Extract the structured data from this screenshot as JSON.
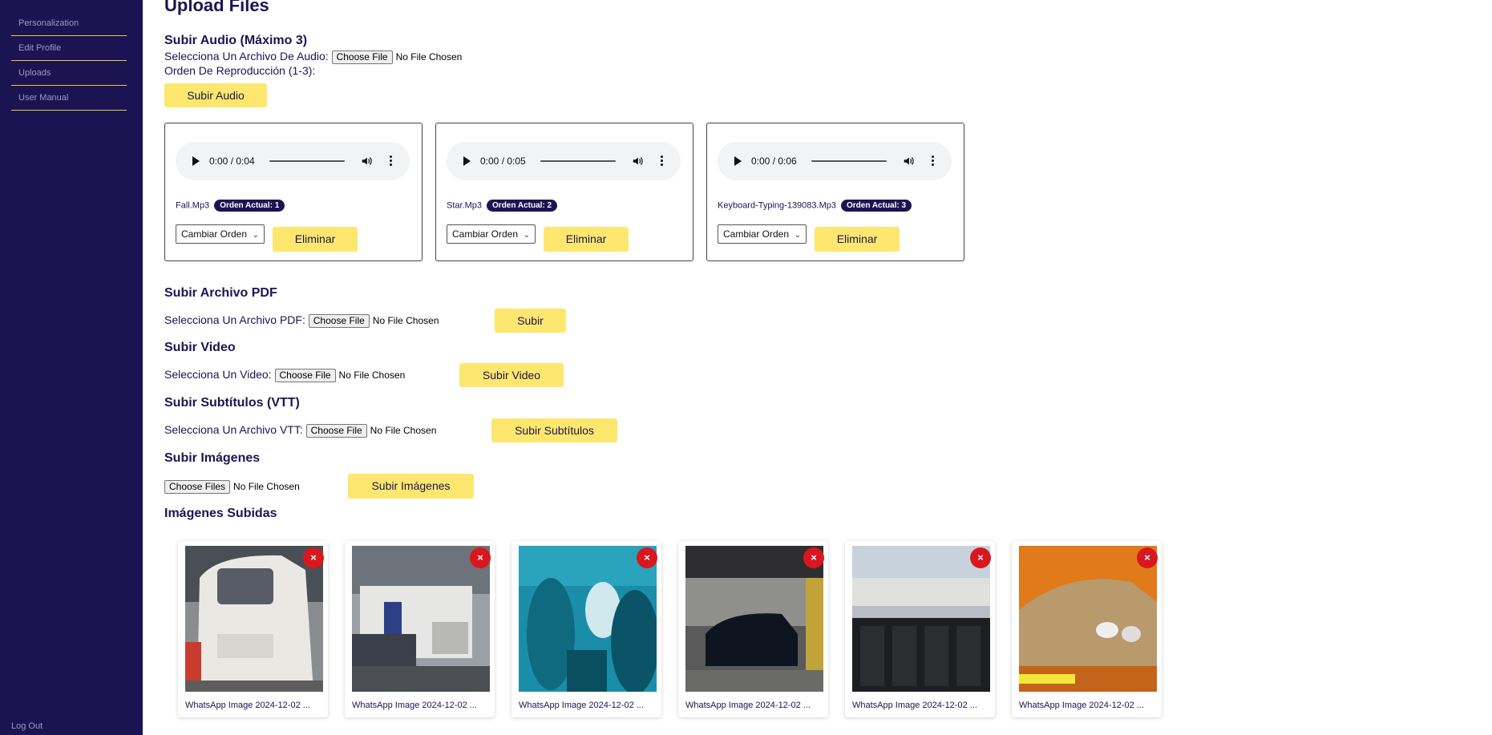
{
  "sidebar": {
    "items": [
      {
        "label": "Personalization"
      },
      {
        "label": "Edit Profile"
      },
      {
        "label": "Uploads"
      },
      {
        "label": "User Manual"
      }
    ],
    "logout_label": "Log Out"
  },
  "page": {
    "title": "Upload Files"
  },
  "audio": {
    "title": "Subir Audio (Máximo 3)",
    "select_label": "Selecciona Un Archivo De Audio:",
    "file_button": "Choose File",
    "no_file": "No File Chosen",
    "order_label": "Orden De Reproducción (1-3):",
    "submit_label": "Subir Audio",
    "tracks": [
      {
        "time": "0:00 / 0:04",
        "name": "Fall.Mp3",
        "badge": "Orden Actual: 1",
        "select": "Cambiar Orden",
        "delete": "Eliminar"
      },
      {
        "time": "0:00 / 0:05",
        "name": "Star.Mp3",
        "badge": "Orden Actual: 2",
        "select": "Cambiar Orden",
        "delete": "Eliminar"
      },
      {
        "time": "0:00 / 0:06",
        "name": "Keyboard-Typing-139083.Mp3",
        "badge": "Orden Actual: 3",
        "select": "Cambiar Orden",
        "delete": "Eliminar"
      }
    ]
  },
  "pdf": {
    "title": "Subir Archivo PDF",
    "select_label": "Selecciona Un Archivo PDF:",
    "file_button": "Choose File",
    "no_file": "No File Chosen",
    "submit_label": "Subir"
  },
  "video": {
    "title": "Subir Video",
    "select_label": "Selecciona Un Video:",
    "file_button": "Choose File",
    "no_file": "No File Chosen",
    "submit_label": "Subir Video"
  },
  "subtitles": {
    "title": "Subir Subtítulos (VTT)",
    "select_label": "Selecciona Un Archivo VTT:",
    "file_button": "Choose File",
    "no_file": "No File Chosen",
    "submit_label": "Subir Subtítulos"
  },
  "images": {
    "title": "Subir Imágenes",
    "file_button": "Choose Files",
    "no_file": "No File Chosen",
    "submit_label": "Subir Imágenes",
    "uploaded_title": "Imágenes Subidas",
    "delete_symbol": "×",
    "items": [
      {
        "caption": "WhatsApp Image 2024-12-02 ..."
      },
      {
        "caption": "WhatsApp Image 2024-12-02 ..."
      },
      {
        "caption": "WhatsApp Image 2024-12-02 ..."
      },
      {
        "caption": "WhatsApp Image 2024-12-02 ..."
      },
      {
        "caption": "WhatsApp Image 2024-12-02 ..."
      },
      {
        "caption": "WhatsApp Image 2024-12-02 ..."
      }
    ]
  },
  "colors": {
    "sidebar_bg": "#1c1452",
    "accent_yellow": "#fde76e",
    "divider_gold": "#e8c93a",
    "delete_red": "#d9171e"
  }
}
